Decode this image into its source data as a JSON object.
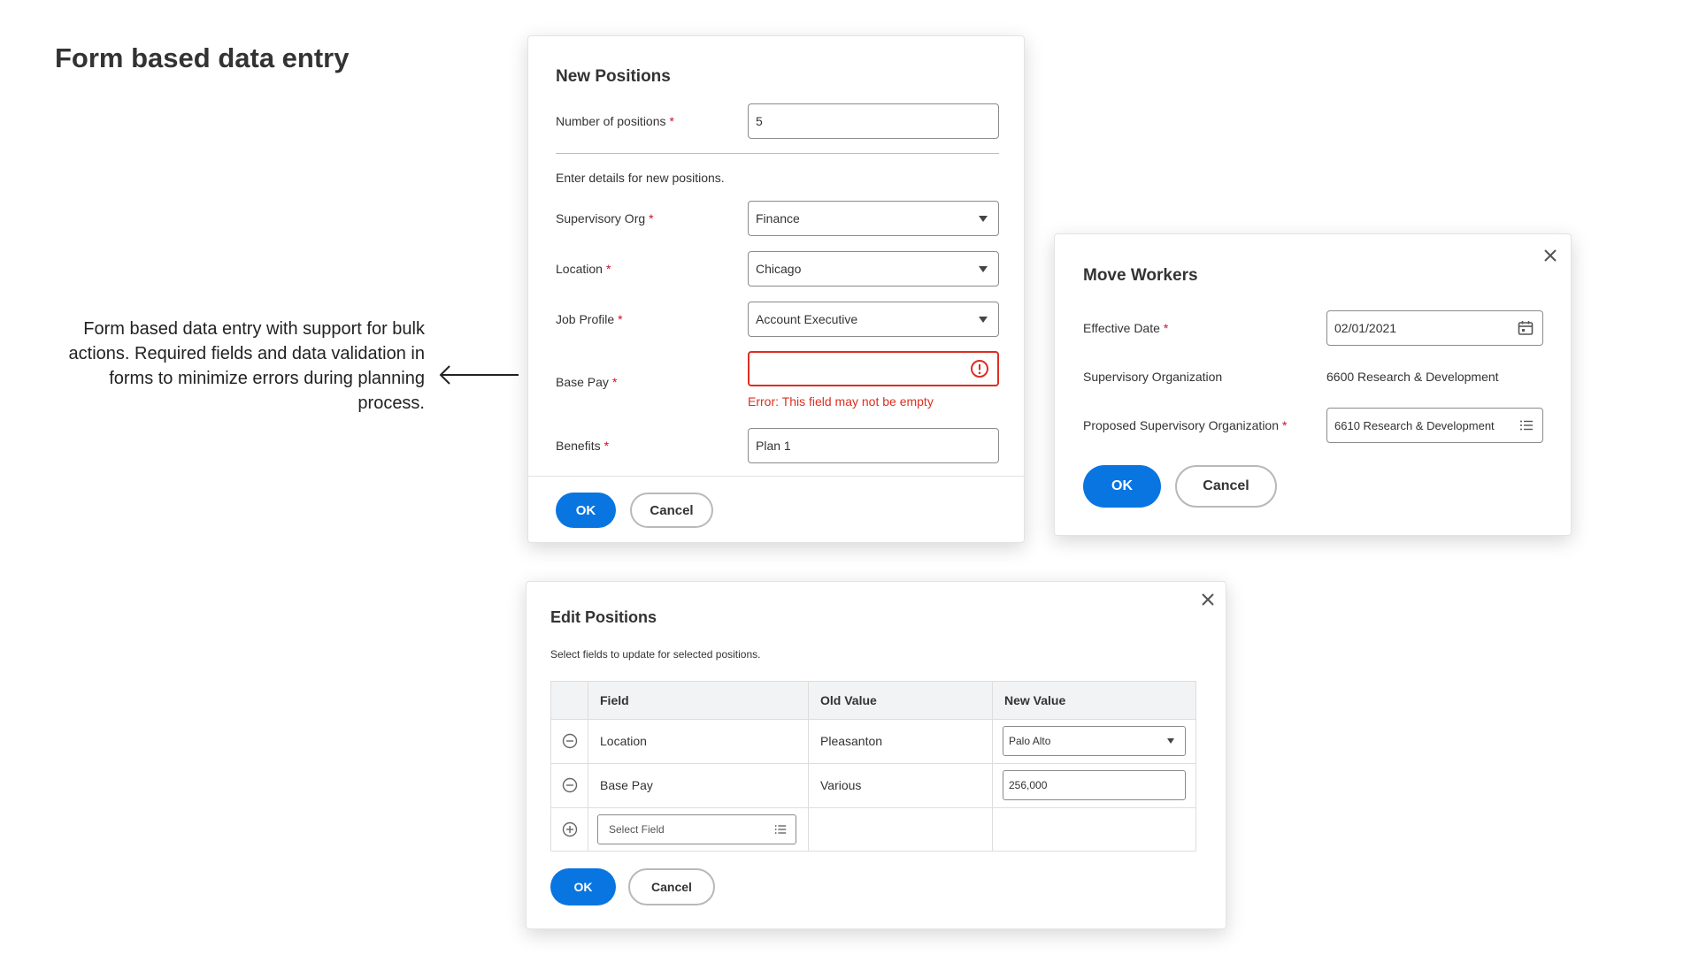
{
  "page": {
    "title": "Form based data entry",
    "annotation": "Form based data entry with support for bulk actions. Required fields and data validation in forms to minimize errors during planning process."
  },
  "colors": {
    "primary": "#0875e1",
    "error": "#de2e21",
    "required": "#c8102e"
  },
  "new_positions": {
    "title": "New Positions",
    "number_label": "Number of positions",
    "number_value": "5",
    "details_text": "Enter details for new positions.",
    "org_label": "Supervisory Org",
    "org_value": "Finance",
    "location_label": "Location",
    "location_value": "Chicago",
    "job_label": "Job Profile",
    "job_value": "Account Executive",
    "pay_label": "Base Pay",
    "pay_value": "",
    "error_prefix": "Error:",
    "error_text": "This field may not be empty",
    "benefits_label": "Benefits",
    "benefits_value": "Plan 1",
    "ok": "OK",
    "cancel": "Cancel",
    "required_mark": "*"
  },
  "move_workers": {
    "title": "Move Workers",
    "date_label": "Effective Date",
    "date_value": "02/01/2021",
    "org_label": "Supervisory Organization",
    "org_value": "6600 Research & Development",
    "proposed_label": "Proposed Supervisory Organization",
    "proposed_value": "6610 Research & Development",
    "ok": "OK",
    "cancel": "Cancel",
    "required_mark": "*"
  },
  "edit_positions": {
    "title": "Edit Positions",
    "subtitle": "Select fields to update for selected positions.",
    "headers": {
      "field": "Field",
      "old": "Old Value",
      "new": "New Value"
    },
    "rows": [
      {
        "field": "Location",
        "old": "Pleasanton",
        "new": "Palo Alto"
      },
      {
        "field": "Base Pay",
        "old": "Various",
        "new": "256,000"
      }
    ],
    "select_placeholder": "Select Field",
    "ok": "OK",
    "cancel": "Cancel"
  },
  "icons": {
    "close": "close-icon",
    "calendar": "calendar-icon",
    "list": "list-icon",
    "error": "error-circle-icon",
    "minus": "minus-circle-icon",
    "plus": "plus-circle-icon"
  }
}
